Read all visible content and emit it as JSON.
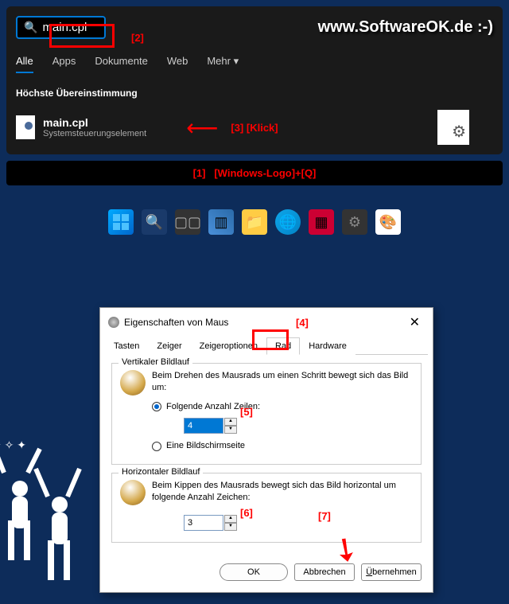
{
  "search": {
    "query": "main.cpl",
    "tabs": [
      "Alle",
      "Apps",
      "Dokumente",
      "Web",
      "Mehr"
    ],
    "best_match_label": "Höchste Übereinstimmung",
    "result_title": "main.cpl",
    "result_subtitle": "Systemsteuerungselement"
  },
  "watermark": "www.SoftwareOK.de :-)",
  "annotations": {
    "a1": "[1]",
    "a1_text": "[Windows-Logo]+[Q]",
    "a2": "[2]",
    "a3": "[3]",
    "a3_text": "[Klick]",
    "a4": "[4]",
    "a5": "[5]",
    "a6": "[6]",
    "a7": "[7]"
  },
  "dialog": {
    "title": "Eigenschaften von Maus",
    "tabs": [
      "Tasten",
      "Zeiger",
      "Zeigeroptionen",
      "Rad",
      "Hardware"
    ],
    "vertical": {
      "legend": "Vertikaler Bildlauf",
      "desc": "Beim Drehen des Mausrads um einen Schritt bewegt sich das Bild um:",
      "opt_lines": "Folgende Anzahl Zeilen:",
      "lines_value": "4",
      "opt_page": "Eine Bildschirmseite"
    },
    "horizontal": {
      "legend": "Horizontaler Bildlauf",
      "desc": "Beim Kippen des Mausrads bewegt sich das Bild horizontal um folgende Anzahl Zeichen:",
      "chars_value": "3"
    },
    "buttons": {
      "ok": "OK",
      "cancel": "Abbrechen",
      "apply": "Übernehmen"
    }
  }
}
